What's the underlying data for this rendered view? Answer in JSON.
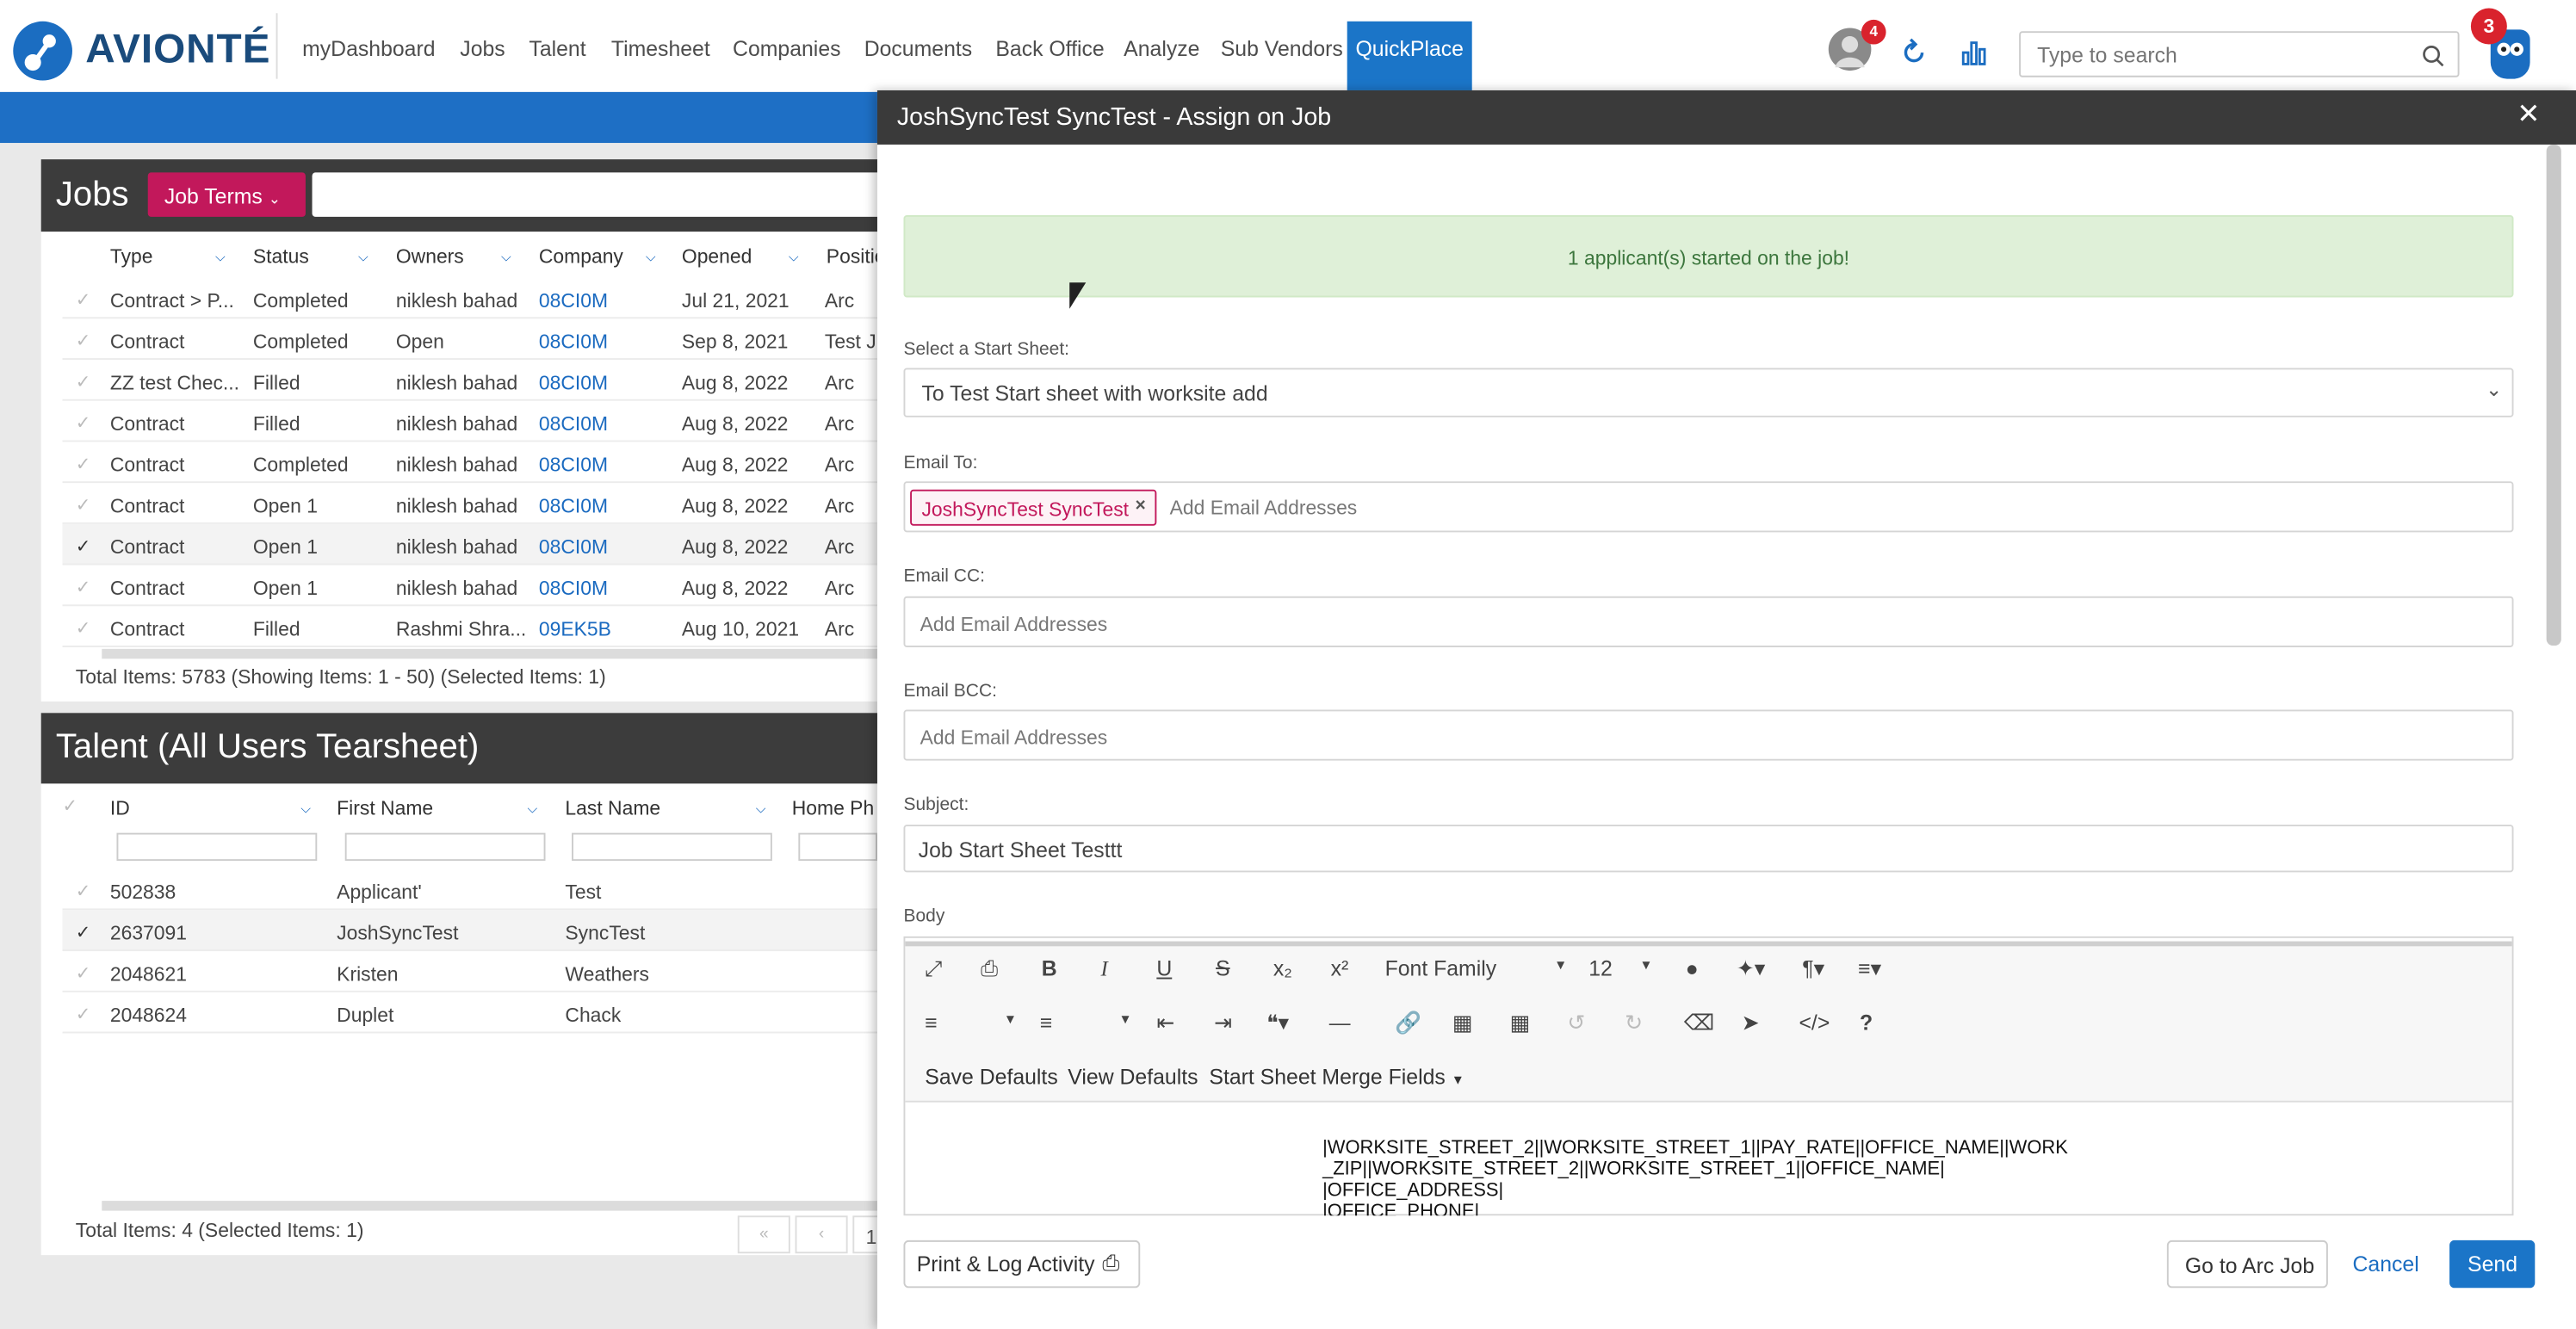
{
  "nav": {
    "brand": "AVIONTÉ",
    "items": [
      "myDashboard",
      "Jobs",
      "Talent",
      "Timesheet",
      "Companies",
      "Documents",
      "Back Office",
      "Analyze",
      "Sub Vendors",
      "QuickPlace"
    ],
    "avatar_badge": "4",
    "owl_badge": "3",
    "search_placeholder": "Type to search",
    "accent": "#1b75c8"
  },
  "jobs": {
    "title": "Jobs",
    "terms_button": "Job Terms",
    "columns": [
      "Type",
      "Status",
      "Owners",
      "Company",
      "Opened",
      "Positio"
    ],
    "rows": [
      {
        "type": "Contract > P...",
        "status": "Completed",
        "owner": "niklesh bahad",
        "company": "08CI0M",
        "opened": "Jul 21, 2021",
        "position": "Arc"
      },
      {
        "type": "Contract",
        "status": "Completed",
        "owner": "Open",
        "company": "08CI0M",
        "opened": "Sep 8, 2021",
        "position": "Test J"
      },
      {
        "type": "ZZ test Chec...",
        "status": "Filled",
        "owner": "niklesh bahad",
        "company": "08CI0M",
        "opened": "Aug 8, 2022",
        "position": "Arc"
      },
      {
        "type": "Contract",
        "status": "Filled",
        "owner": "niklesh bahad",
        "company": "08CI0M",
        "opened": "Aug 8, 2022",
        "position": "Arc"
      },
      {
        "type": "Contract",
        "status": "Completed",
        "owner": "niklesh bahad",
        "company": "08CI0M",
        "opened": "Aug 8, 2022",
        "position": "Arc"
      },
      {
        "type": "Contract",
        "status": "Open 1",
        "owner": "niklesh bahad",
        "company": "08CI0M",
        "opened": "Aug 8, 2022",
        "position": "Arc"
      },
      {
        "type": "Contract",
        "status": "Open 1",
        "owner": "niklesh bahad",
        "company": "08CI0M",
        "opened": "Aug 8, 2022",
        "position": "Arc",
        "selected": true
      },
      {
        "type": "Contract",
        "status": "Open 1",
        "owner": "niklesh bahad",
        "company": "08CI0M",
        "opened": "Aug 8, 2022",
        "position": "Arc"
      },
      {
        "type": "Contract",
        "status": "Filled",
        "owner": "Rashmi Shra...",
        "company": "09EK5B",
        "opened": "Aug 10, 2021",
        "position": "Arc"
      }
    ],
    "total": "Total Items: 5783 (Showing Items: 1 - 50) (Selected Items: 1)"
  },
  "talent": {
    "title": "Talent (All Users Tearsheet)",
    "columns": [
      "ID",
      "First Name",
      "Last Name",
      "Home Ph"
    ],
    "rows": [
      {
        "id": "502838",
        "first": "Applicant'",
        "last": "Test"
      },
      {
        "id": "2637091",
        "first": "JoshSyncTest",
        "last": "SyncTest",
        "selected": true
      },
      {
        "id": "2048621",
        "first": "Kristen",
        "last": "Weathers"
      },
      {
        "id": "2048624",
        "first": "Duplet",
        "last": "Chack"
      }
    ],
    "total": "Total Items: 4 (Selected Items: 1)",
    "page": "1"
  },
  "modal": {
    "title": "JoshSyncTest SyncTest - Assign on Job",
    "alert": "1 applicant(s) started on the job!",
    "start_sheet_label": "Select a Start Sheet:",
    "start_sheet_value": "To Test Start sheet with worksite add",
    "email_to_label": "Email To:",
    "email_to_tag": "JoshSyncTest SyncTest",
    "email_to_placeholder": "Add Email Addresses",
    "email_cc_label": "Email CC:",
    "email_cc_placeholder": "Add Email Addresses",
    "email_bcc_label": "Email BCC:",
    "email_bcc_placeholder": "Add Email Addresses",
    "subject_label": "Subject:",
    "subject_value": "Job Start Sheet Testtt",
    "body_label": "Body",
    "toolbar": {
      "font_family": "Font Family",
      "font_size": "12",
      "save_defaults": "Save Defaults",
      "view_defaults": "View Defaults",
      "merge_fields": "Start Sheet Merge Fields"
    },
    "body_lines": [
      "|WORKSITE_STREET_2||WORKSITE_STREET_1||PAY_RATE||OFFICE_NAME||WORK",
      "_ZIP||WORKSITE_STREET_2||WORKSITE_STREET_1||OFFICE_NAME|",
      "|OFFICE_ADDRESS|",
      "|OFFICE_PHONE|"
    ],
    "print_button": "Print & Log Activity",
    "arc_button": "Go to Arc Job",
    "cancel_button": "Cancel",
    "send_button": "Send"
  }
}
